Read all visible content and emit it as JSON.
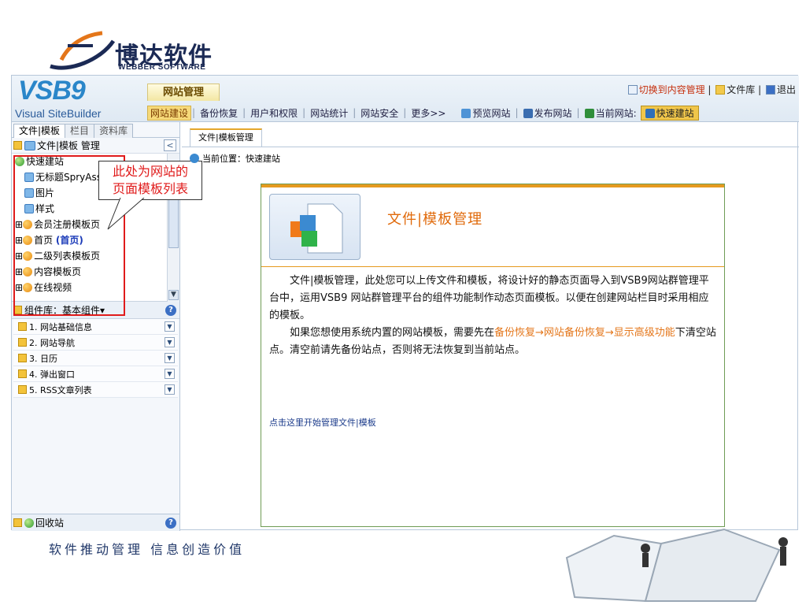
{
  "brand": {
    "cn": "博达软件",
    "en": "WEBBER SOFTWARE"
  },
  "app": {
    "logo_big": "VSB9",
    "logo_sub": "Visual SiteBuilder",
    "section_tab": "网站管理"
  },
  "top_right": {
    "switch": "切换到内容管理",
    "files": "文件库",
    "exit": "退出"
  },
  "menu": [
    "网站建设",
    "备份恢复",
    "用户和权限",
    "网站统计",
    "网站安全",
    "更多>>"
  ],
  "menu_actions": {
    "preview": "预览网站",
    "publish": "发布网站",
    "current": "当前网站:",
    "quick": "快速建站"
  },
  "left_tabs": [
    "文件|模板",
    "栏目",
    "资料库"
  ],
  "left_header": "文件|模板 管理",
  "tree": [
    {
      "label": "快速建站"
    },
    {
      "label": "无标题SpryAssets"
    },
    {
      "label": "图片"
    },
    {
      "label": "样式"
    },
    {
      "label": "会员注册模板页"
    },
    {
      "label": "首页",
      "extra": "(首页)"
    },
    {
      "label": "二级列表模板页"
    },
    {
      "label": "内容模板页"
    },
    {
      "label": "在线视频"
    }
  ],
  "callout": {
    "line1": "此处为网站的",
    "line2": "页面模板列表"
  },
  "components": {
    "header": "组件库：基本组件▾",
    "items": [
      "1. 网站基础信息",
      "2. 网站导航",
      "3. 日历",
      "4. 弹出窗口",
      "5. RSS文章列表"
    ]
  },
  "recycle": "回收站",
  "content": {
    "tab": "文件|模板管理",
    "breadcrumb": "当前位置：快速建站",
    "title": "文件|模板管理",
    "para1": "文件|模板管理，此处您可以上传文件和模板，将设计好的静态页面导入到VSB9网站群管理平台中，运用VSB9 网站群管理平台的组件功能制作动态页面模板。以便在创建网站栏目时采用相应的模板。",
    "para2_pre": "如果您想使用系统内置的网站模板，需要先在",
    "para2_hl": "备份恢复→网站备份恢复→显示高级功能",
    "para2_post": "下清空站点。清空前请先备份站点，否则将无法恢复到当前站点。",
    "link": "点击这里开始管理文件|模板"
  },
  "slogan": "软件推动管理 信息创造价值",
  "colors": {
    "accent": "#e59a1f",
    "brand": "#1b2a55",
    "highlight": "#e01b1b"
  }
}
